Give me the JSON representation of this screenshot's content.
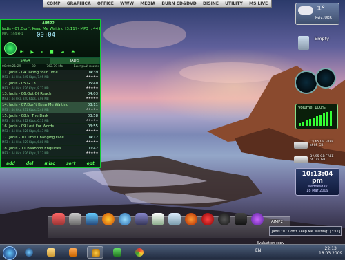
{
  "menu": [
    "COMP",
    "GRAPHICA",
    "OFFICE",
    "WWW",
    "MEDIA",
    "BURN CD&DVD",
    "DISINE",
    "UTILITY",
    "MS LIVE"
  ],
  "player": {
    "brand": "AIMP2",
    "now_playing": "Jadis - 07.Don't Keep Me Waiting [3:11] - MP3 :: 44 kHz, 231 kbps, 5.48 MB",
    "format_info": "MP3 :: 44 kHz",
    "time": "00:04",
    "tabs": [
      "SAGA",
      "JADIS"
    ],
    "status_left": "00:00:21:29",
    "status_count": "30",
    "status_size": "762.79 Mb",
    "status_right": "Быстрый поиск",
    "playlist": [
      {
        "title": "11. Jadis - 04.Taking Your Time",
        "duration": "04:39",
        "meta": "MP3 :: 44 kHz, 245 Kbps, 7.95 MB"
      },
      {
        "title": "12. Jadis - 05.G.13",
        "duration": "05:40",
        "meta": "MP3 :: 44 kHz, 226 Kbps, 8.72 MB"
      },
      {
        "title": "13. Jadis - 06.Out Of Reach",
        "duration": "04:03",
        "meta": "MP3 :: 44 kHz, 240 Kbps, 7.08 MB"
      },
      {
        "title": "14. Jadis - 07.Don't Keep Me Waiting",
        "duration": "03:11",
        "meta": "MP3 :: 44 kHz, 231 Kbps, 5.48 MB"
      },
      {
        "title": "15. Jadis - 08.In The Dark",
        "duration": "03:58",
        "meta": "MP3 :: 44 kHz, 212 Kbps, 6.11 MB"
      },
      {
        "title": "16. Jadis - 09.Lost For Words",
        "duration": "03:55",
        "meta": "MP3 :: 44 kHz, 226 Kbps, 6.43 MB"
      },
      {
        "title": "17. Jadis - 10.Time Changing Face",
        "duration": "04:12",
        "meta": "MP3 :: 44 kHz, 229 Kbps, 6.88 MB"
      },
      {
        "title": "18. Jadis - 11.Baaboon Enquiries",
        "duration": "00:42",
        "meta": "MP3 :: 44 kHz, 226 Kbps, 1.17 MB"
      }
    ],
    "rating": "★★★★★",
    "selected_index": 3,
    "bottom_buttons": [
      "add",
      "del",
      "misc",
      "sort",
      "opt"
    ]
  },
  "weather": {
    "temp": "1°",
    "location": "Kyiv, UKR"
  },
  "recycle_bin": {
    "label": "Empty"
  },
  "volume": {
    "label": "Volume: 100%",
    "level": 1.0
  },
  "drives": [
    {
      "line1": "C:\\ 65 GB FREE",
      "line2": "of 85 GB"
    },
    {
      "line1": "D:\\ 95 GB FREE",
      "line2": "of 149 GB"
    }
  ],
  "clock": {
    "time": "10:13:04 pm",
    "day": "Wednesday",
    "date": "18 Mar 2009"
  },
  "notification": {
    "title": "AIMP2",
    "text": "Jadis \"07.Don't Keep Me Waiting\" [3:11]"
  },
  "evaluation": "Evaluation copy",
  "tray": {
    "lang": "EN",
    "time": "22:13",
    "date": "18.03.2009"
  },
  "colors": {
    "accent": "#33ff33",
    "player_bg": "#0a1910"
  }
}
